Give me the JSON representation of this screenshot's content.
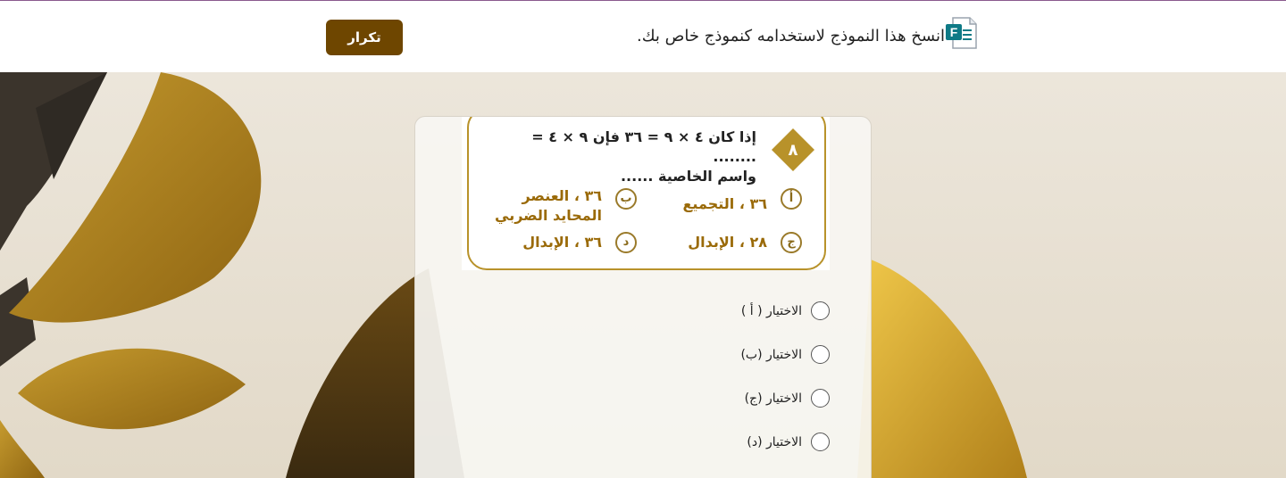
{
  "header": {
    "banner_text": "انسخ هذا النموذج لاستخدامه كنموذج خاص بك.",
    "repeat_label": "تكرار",
    "icon": "microsoft-forms-icon",
    "accent": "#6e4600"
  },
  "question": {
    "number": "٨",
    "text_line1": "إذا كان ٤ × ٩ = ٣٦ فإن ٩ × ٤ = ........",
    "text_line2": "واسم الخاصية ......",
    "options": [
      {
        "letter": "أ",
        "text": "٣٦ ، التجميع"
      },
      {
        "letter": "ب",
        "text_line1": "٣٦ ، العنصر",
        "text_line2": "المحايد الضربي"
      },
      {
        "letter": "ج",
        "text": "٢٨ ، الإبدال"
      },
      {
        "letter": "د",
        "text": "٣٦ ، الإبدال"
      }
    ]
  },
  "choices": [
    {
      "label": "الاختيار ( أ )"
    },
    {
      "label": "الاختيار (ب)"
    },
    {
      "label": "الاختيار (ج)"
    },
    {
      "label": "الاختيار (د)"
    }
  ]
}
